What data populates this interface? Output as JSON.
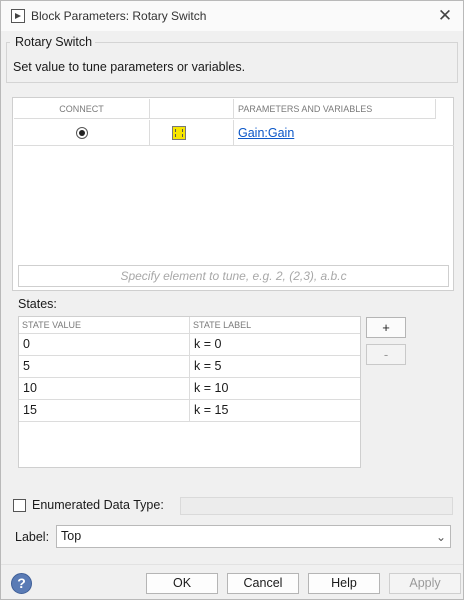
{
  "window": {
    "title": "Block Parameters: Rotary Switch"
  },
  "group": {
    "title": "Rotary Switch",
    "description": "Set value to tune parameters or variables."
  },
  "params_table": {
    "headers": {
      "connect": "CONNECT",
      "blank": "",
      "params": "PARAMETERS AND VARIABLES"
    },
    "rows": [
      {
        "connected": true,
        "icon": "variable-icon",
        "name": "Gain:Gain"
      }
    ],
    "element_placeholder": "Specify element to tune, e.g. 2, (2,3), a.b.c"
  },
  "states": {
    "label": "States:",
    "headers": {
      "value": "STATE VALUE",
      "label": "STATE LABEL"
    },
    "rows": [
      {
        "value": "0",
        "label": "k = 0"
      },
      {
        "value": "5",
        "label": "k = 5"
      },
      {
        "value": "10",
        "label": "k = 10"
      },
      {
        "value": "15",
        "label": "k = 15"
      }
    ],
    "add_label": "+",
    "remove_label": "-"
  },
  "enumerated": {
    "label": "Enumerated Data Type:",
    "checked": false,
    "value": ""
  },
  "label_field": {
    "caption": "Label:",
    "selected": "Top"
  },
  "footer": {
    "ok": "OK",
    "cancel": "Cancel",
    "help": "Help",
    "apply": "Apply",
    "help_icon": "?"
  },
  "colors": {
    "link": "#0b57c8",
    "variable_icon": "#f7e600",
    "help_icon": "#5a7bb5"
  }
}
